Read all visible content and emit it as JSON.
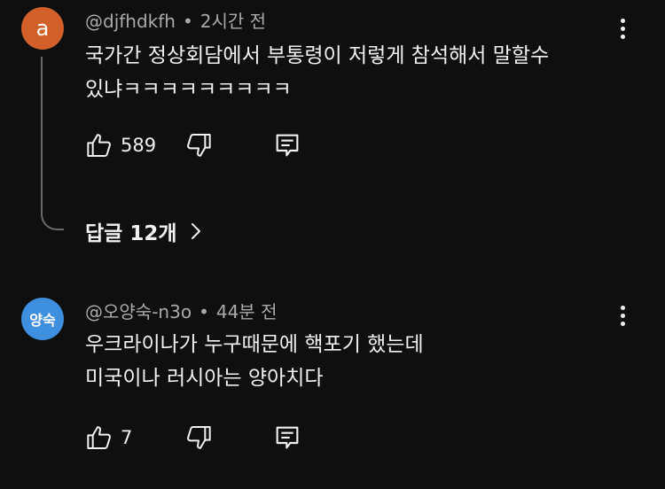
{
  "comments": [
    {
      "avatar_text": "a",
      "avatar_color": "#d1602b",
      "username": "@djfhdkfh",
      "time": "2시간 전",
      "text_lines": [
        "국가간 정상회담에서 부통령이 저렇게 참석해서 말할수",
        "있냐ㅋㅋㅋㅋㅋㅋㅋㅋㅋ"
      ],
      "likes": "589",
      "replies_label": "답글 12개"
    },
    {
      "avatar_text": "양숙",
      "avatar_color": "#3f8fe0",
      "username": "@오양숙-n3o",
      "time": "44분 전",
      "text_lines": [
        "우크라이나가 누구때문에 핵포기 했는데",
        "미국이나 러시아는 양아치다"
      ],
      "likes": "7"
    }
  ],
  "meta_separator": "•",
  "icons": {
    "like": "thumbs-up-icon",
    "dislike": "thumbs-down-icon",
    "reply": "reply-comment-icon",
    "more": "more-vertical-icon",
    "chevron": "chevron-right-icon"
  },
  "colors": {
    "background": "#0f0f0f",
    "text": "#f1f1f1",
    "secondary_text": "#aaaaaa",
    "thread_line": "#6a6a6a"
  }
}
